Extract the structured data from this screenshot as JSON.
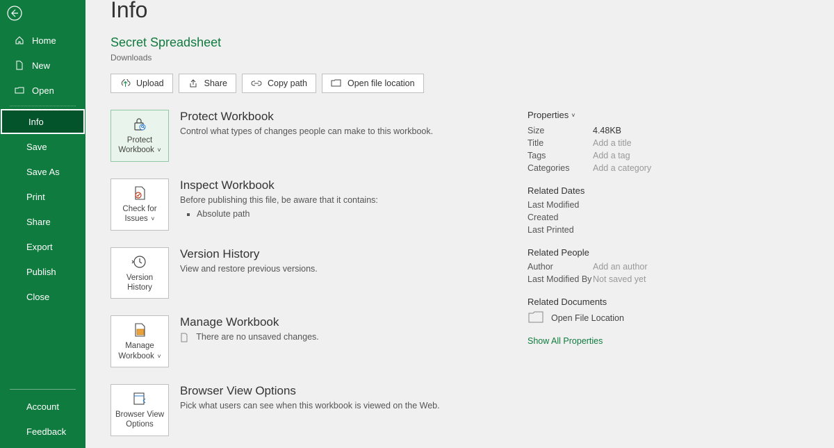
{
  "sidebar": {
    "home": "Home",
    "new": "New",
    "open": "Open",
    "info": "Info",
    "save": "Save",
    "save_as": "Save As",
    "print": "Print",
    "share": "Share",
    "export": "Export",
    "publish": "Publish",
    "close": "Close",
    "account": "Account",
    "feedback": "Feedback"
  },
  "page": {
    "title": "Info",
    "file_name": "Secret Spreadsheet",
    "file_path": "Downloads"
  },
  "actions": {
    "upload": "Upload",
    "share": "Share",
    "copy_path": "Copy path",
    "open_loc": "Open file location"
  },
  "sections": {
    "protect": {
      "tile": "Protect Workbook",
      "title": "Protect Workbook",
      "desc": "Control what types of changes people can make to this workbook."
    },
    "inspect": {
      "tile": "Check for Issues",
      "title": "Inspect Workbook",
      "desc": "Before publishing this file, be aware that it contains:",
      "item1": "Absolute path"
    },
    "version": {
      "tile": "Version History",
      "title": "Version History",
      "desc": "View and restore previous versions."
    },
    "manage": {
      "tile": "Manage Workbook",
      "title": "Manage Workbook",
      "desc": "There are no unsaved changes."
    },
    "browser": {
      "tile": "Browser View Options",
      "title": "Browser View Options",
      "desc": "Pick what users can see when this workbook is viewed on the Web."
    }
  },
  "props": {
    "header": "Properties",
    "size_k": "Size",
    "size_v": "4.48KB",
    "title_k": "Title",
    "title_v": "Add a title",
    "tags_k": "Tags",
    "tags_v": "Add a tag",
    "cat_k": "Categories",
    "cat_v": "Add a category",
    "dates_h": "Related Dates",
    "mod_k": "Last Modified",
    "created_k": "Created",
    "printed_k": "Last Printed",
    "people_h": "Related People",
    "author_k": "Author",
    "author_v": "Add an author",
    "modby_k": "Last Modified By",
    "modby_v": "Not saved yet",
    "docs_h": "Related Documents",
    "open_loc": "Open File Location",
    "show_all": "Show All Properties"
  }
}
